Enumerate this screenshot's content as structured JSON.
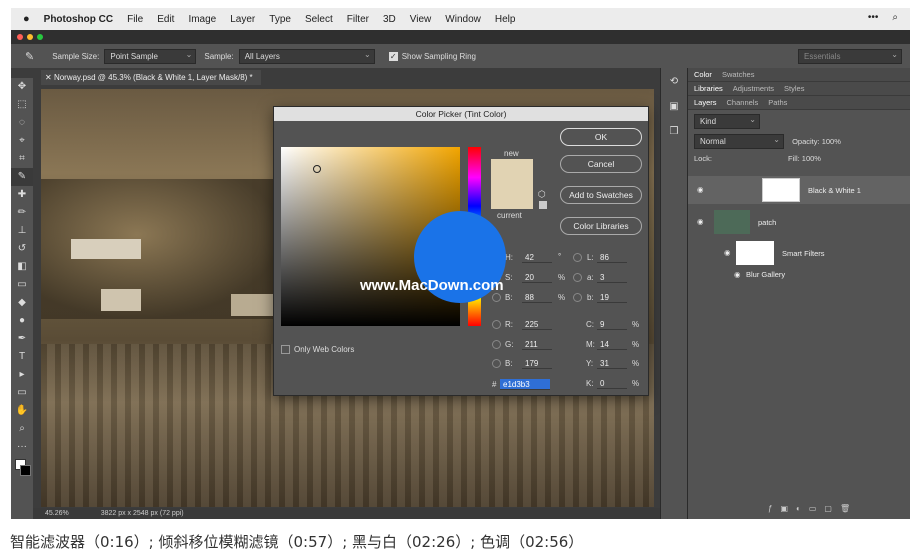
{
  "menubar": {
    "app": "Photoshop CC",
    "items": [
      "File",
      "Edit",
      "Image",
      "Layer",
      "Type",
      "Select",
      "Filter",
      "3D",
      "View",
      "Window",
      "Help"
    ]
  },
  "options": {
    "sample_size_label": "Sample Size:",
    "sample_size_value": "Point Sample",
    "sample_label": "Sample:",
    "sample_value": "All Layers",
    "show_ring": "Show Sampling Ring",
    "workspace": "Essentials"
  },
  "document": {
    "tab": "Norway.psd @ 45.3% (Black & White 1, Layer Mask/8) *",
    "zoom": "45.26%",
    "size": "3822 px x 2548 px (72 ppi)"
  },
  "picker": {
    "title": "Color Picker (Tint Color)",
    "new": "new",
    "current": "current",
    "ok": "OK",
    "cancel": "Cancel",
    "add_swatches": "Add to Swatches",
    "libraries": "Color Libraries",
    "only_web": "Only Web Colors",
    "H": "42",
    "S": "20",
    "B": "88",
    "R": "225",
    "G": "211",
    "B2": "179",
    "L": "86",
    "a": "3",
    "b": "19",
    "C": "9",
    "M": "14",
    "Y": "31",
    "K": "0",
    "hex": "e1d3b3",
    "deg": "°",
    "pct": "%",
    "hash": "#",
    "lblH": "H:",
    "lblS": "S:",
    "lblB": "B:",
    "lblR": "R:",
    "lblG": "G:",
    "lblBB": "B:",
    "lblL": "L:",
    "lbla": "a:",
    "lblb": "b:",
    "lblC": "C:",
    "lblM": "M:",
    "lblY": "Y:",
    "lblK": "K:"
  },
  "panels": {
    "tabs1": [
      "Color",
      "Swatches"
    ],
    "tabs2": [
      "Libraries",
      "Adjustments",
      "Styles"
    ],
    "tabs3": [
      "Layers",
      "Channels",
      "Paths"
    ],
    "kind": "Kind",
    "blend": "Normal",
    "opacity_label": "Opacity:",
    "opacity": "100%",
    "lock": "Lock:",
    "fill_label": "Fill:",
    "fill": "100%",
    "layers": [
      "Black & White 1",
      "patch",
      "Smart Filters",
      "Blur Gallery"
    ]
  },
  "watermark": "www.MacDown.com",
  "caption": "智能滤波器（0:16）; 倾斜移位模糊滤镜（0:57）; 黑与白（02:26）; 色调（02:56）",
  "colors": {
    "new": "#e1d3b3",
    "accent": "#1a73e8"
  }
}
